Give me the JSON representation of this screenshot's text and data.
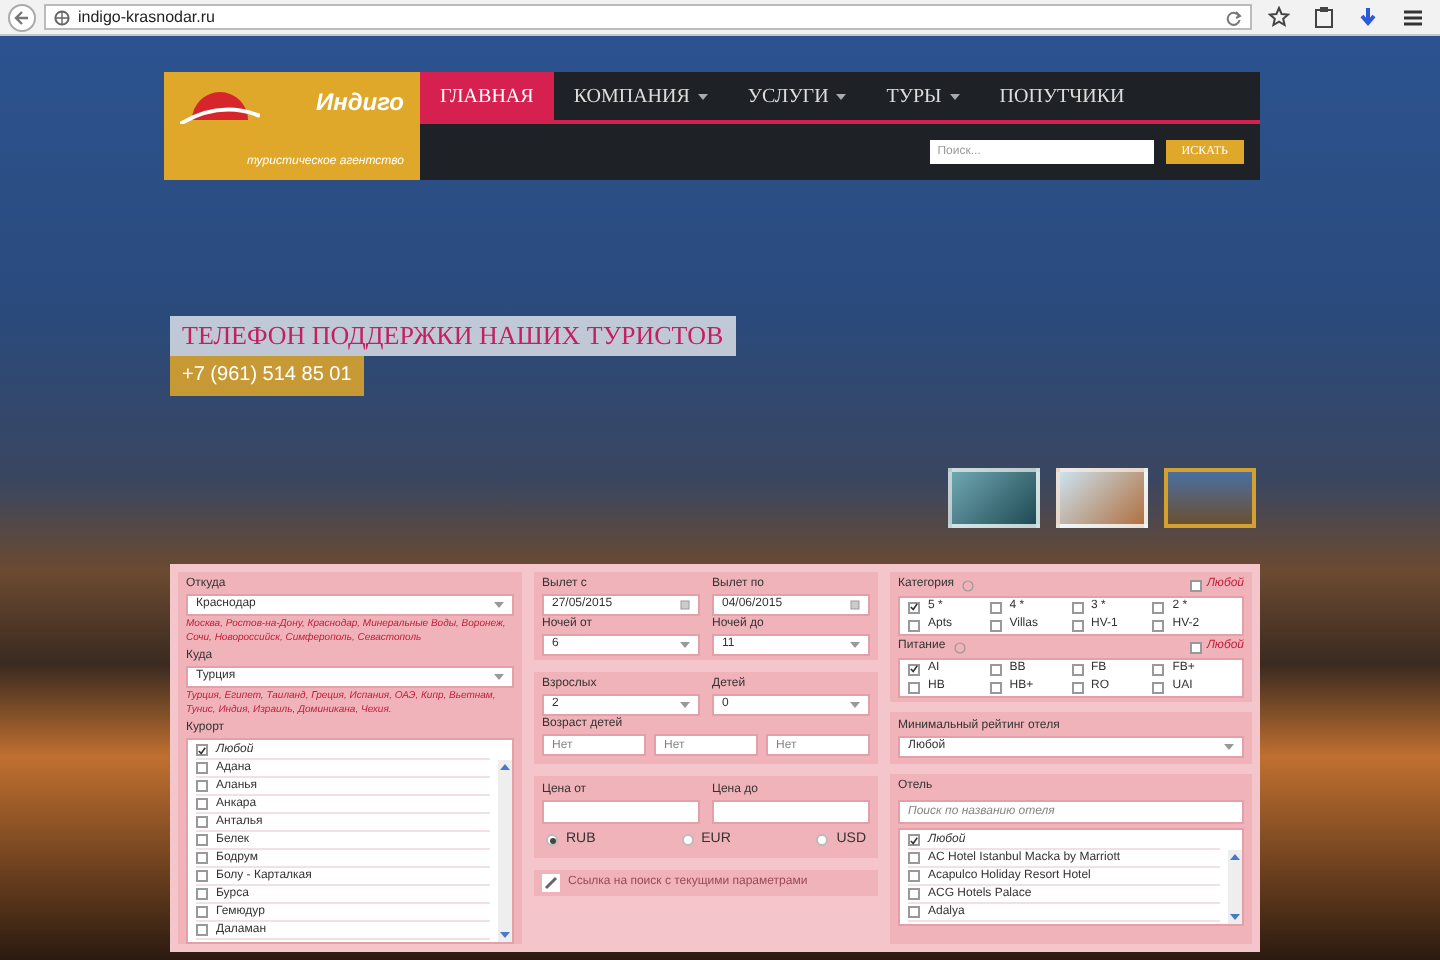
{
  "browser": {
    "url": "indigo-krasnodar.ru"
  },
  "header": {
    "logo": {
      "name": "Индиго",
      "tagline": "туристическое агентство"
    },
    "nav": [
      {
        "label": "ГЛАВНАЯ",
        "selected": true,
        "has_menu": false
      },
      {
        "label": "КОМПАНИЯ",
        "selected": false,
        "has_menu": true
      },
      {
        "label": "УСЛУГИ",
        "selected": false,
        "has_menu": true
      },
      {
        "label": "ТУРЫ",
        "selected": false,
        "has_menu": true
      },
      {
        "label": "ПОПУТЧИКИ",
        "selected": false,
        "has_menu": false
      }
    ],
    "search": {
      "placeholder": "Поиск...",
      "button": "ИСКАТЬ"
    }
  },
  "hero": {
    "title": "ТЕЛЕФОН ПОДДЕРЖКИ НАШИХ ТУРИСТОВ",
    "phone": "+7 (961) 514 85 01",
    "slides": [
      {
        "selected": false
      },
      {
        "selected": false
      },
      {
        "selected": true
      }
    ]
  },
  "form": {
    "from": {
      "label": "Откуда",
      "value": "Краснодар",
      "hint": "Москва, Ростов-на-Дону, Краснодар, Минеральные Воды, Воронеж, Сочи, Новороссийск, Симферополь, Севастополь"
    },
    "to": {
      "label": "Куда",
      "value": "Турция",
      "hint": "Турция, Египет, Таиланд, Греция, Испания, ОАЭ, Кипр, Вьетнам, Тунис, Индия, Израиль, Доминикана, Чехия."
    },
    "resorts": {
      "label": "Курорт",
      "items": [
        {
          "label": "Любой",
          "checked": true
        },
        {
          "label": "Адана",
          "checked": false
        },
        {
          "label": "Аланья",
          "checked": false
        },
        {
          "label": "Анкара",
          "checked": false
        },
        {
          "label": "Анталья",
          "checked": false
        },
        {
          "label": "Белек",
          "checked": false
        },
        {
          "label": "Бодрум",
          "checked": false
        },
        {
          "label": "Болу - Карталкая",
          "checked": false
        },
        {
          "label": "Бурса",
          "checked": false
        },
        {
          "label": "Гемюдур",
          "checked": false
        },
        {
          "label": "Даламан",
          "checked": false
        }
      ]
    },
    "dates": [
      {
        "label": "Вылет с",
        "value": "27/05/2015",
        "kind": "date"
      },
      {
        "label": "Вылет по",
        "value": "04/06/2015",
        "kind": "date"
      },
      {
        "label": "Ночей от",
        "value": "6",
        "kind": "select"
      },
      {
        "label": "Ночей до",
        "value": "11",
        "kind": "select"
      }
    ],
    "people": [
      {
        "label": "Взрослых",
        "value": "2"
      },
      {
        "label": "Детей",
        "value": "0"
      }
    ],
    "children_ages": {
      "label": "Возраст детей",
      "placeholders": [
        "Нет",
        "Нет",
        "Нет"
      ]
    },
    "prices": [
      {
        "label": "Цена от"
      },
      {
        "label": "Цена до"
      }
    ],
    "currencies": [
      {
        "label": "RUB",
        "selected": true
      },
      {
        "label": "EUR",
        "selected": false
      },
      {
        "label": "USD",
        "selected": false
      }
    ],
    "link": "Ссылка на поиск с текущими параметрами",
    "groups": [
      {
        "label": "Категория",
        "any": "Любой",
        "any_checked": false,
        "items": [
          {
            "label": "5 *",
            "checked": true
          },
          {
            "label": "4 *",
            "checked": false
          },
          {
            "label": "3 *",
            "checked": false
          },
          {
            "label": "2 *",
            "checked": false
          },
          {
            "label": "Apts",
            "checked": false
          },
          {
            "label": "Villas",
            "checked": false
          },
          {
            "label": "HV-1",
            "checked": false
          },
          {
            "label": "HV-2",
            "checked": false
          }
        ]
      },
      {
        "label": "Питание",
        "any": "Любой",
        "any_checked": false,
        "items": [
          {
            "label": "AI",
            "checked": true
          },
          {
            "label": "BB",
            "checked": false
          },
          {
            "label": "FB",
            "checked": false
          },
          {
            "label": "FB+",
            "checked": false
          },
          {
            "label": "HB",
            "checked": false
          },
          {
            "label": "HB+",
            "checked": false
          },
          {
            "label": "RO",
            "checked": false
          },
          {
            "label": "UAI",
            "checked": false
          }
        ]
      }
    ],
    "rating": {
      "label": "Минимальный рейтинг отеля",
      "value": "Любой"
    },
    "hotel": {
      "label": "Отель",
      "placeholder": "Поиск по названию отеля",
      "items": [
        {
          "label": "Любой",
          "checked": true
        },
        {
          "label": "AC Hotel Istanbul Macka by Marriott",
          "checked": false
        },
        {
          "label": "Acapulco Holiday Resort Hotel",
          "checked": false
        },
        {
          "label": "ACG Hotels Palace",
          "checked": false
        },
        {
          "label": "Adalya",
          "checked": false
        }
      ]
    }
  }
}
